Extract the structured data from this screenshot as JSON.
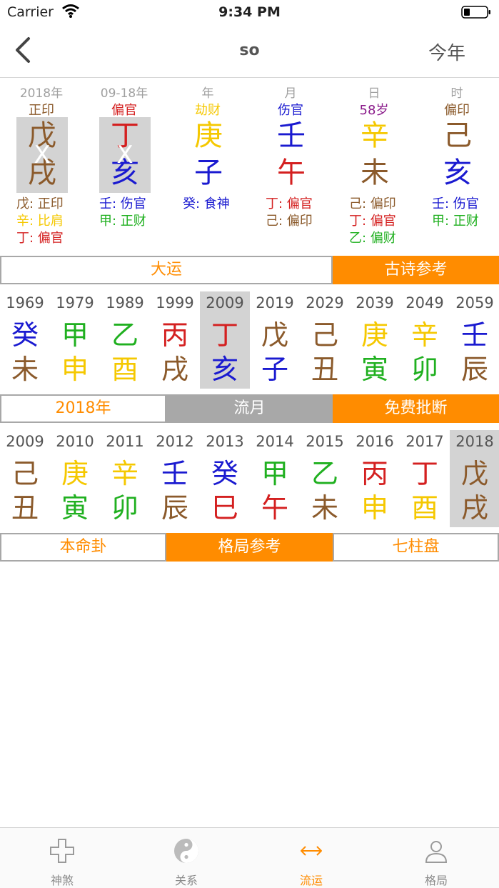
{
  "status": {
    "carrier": "Carrier",
    "time": "9:34 PM"
  },
  "nav": {
    "title": "so",
    "right": "今年"
  },
  "colors": {
    "accent": "#ff8c00",
    "brown": "#8b5a2b",
    "red": "#d42020",
    "blue": "#1a1ad0",
    "green": "#20b020",
    "yellow": "#f5c800",
    "purple": "#8a1a8a",
    "grey": "#a0a0a0"
  },
  "pillars": [
    {
      "lab1": "2018年",
      "lab2": "正印",
      "lab2_color": "#8b5a2b",
      "c1": "戊",
      "c1_color": "#8b5a2b",
      "c2": "戌",
      "c2_color": "#8b5a2b",
      "grey": true,
      "x": "X",
      "hidden": [
        {
          "t": "戊: 正印",
          "c": "#8b5a2b"
        },
        {
          "t": "辛: 比肩",
          "c": "#f5c800"
        },
        {
          "t": "丁: 偏官",
          "c": "#d42020"
        }
      ]
    },
    {
      "lab1": "09-18年",
      "lab2": "偏官",
      "lab2_color": "#d42020",
      "c1": "丁",
      "c1_color": "#d42020",
      "c2": "亥",
      "c2_color": "#1a1ad0",
      "grey": true,
      "x": "X",
      "hidden": [
        {
          "t": "壬: 伤官",
          "c": "#1a1ad0"
        },
        {
          "t": "甲: 正财",
          "c": "#20b020"
        }
      ]
    },
    {
      "lab1": "年",
      "lab2": "劫财",
      "lab2_color": "#f5c800",
      "c1": "庚",
      "c1_color": "#f5c800",
      "c2": "子",
      "c2_color": "#1a1ad0",
      "grey": false,
      "x": "",
      "hidden": [
        {
          "t": "癸: 食神",
          "c": "#1a1ad0"
        }
      ]
    },
    {
      "lab1": "月",
      "lab2": "伤官",
      "lab2_color": "#1a1ad0",
      "c1": "壬",
      "c1_color": "#1a1ad0",
      "c2": "午",
      "c2_color": "#d42020",
      "grey": false,
      "x": "",
      "hidden": [
        {
          "t": "丁: 偏官",
          "c": "#d42020"
        },
        {
          "t": "己: 偏印",
          "c": "#8b5a2b"
        }
      ]
    },
    {
      "lab1": "日",
      "lab2": "58岁",
      "lab2_color": "#8a1a8a",
      "c1": "辛",
      "c1_color": "#f5c800",
      "c2": "未",
      "c2_color": "#8b5a2b",
      "grey": false,
      "x": "",
      "hidden": [
        {
          "t": "己: 偏印",
          "c": "#8b5a2b"
        },
        {
          "t": "丁: 偏官",
          "c": "#d42020"
        },
        {
          "t": "乙: 偏财",
          "c": "#20b020"
        }
      ]
    },
    {
      "lab1": "时",
      "lab2": "偏印",
      "lab2_color": "#8b5a2b",
      "c1": "己",
      "c1_color": "#8b5a2b",
      "c2": "亥",
      "c2_color": "#1a1ad0",
      "grey": false,
      "x": "",
      "hidden": [
        {
          "t": "壬: 伤官",
          "c": "#1a1ad0"
        },
        {
          "t": "甲: 正财",
          "c": "#20b020"
        }
      ]
    }
  ],
  "row1": {
    "dayun": "大运",
    "poem": "古诗参考"
  },
  "dayun": [
    {
      "y": "1969",
      "g1": "癸",
      "c1": "#1a1ad0",
      "g2": "未",
      "c2": "#8b5a2b",
      "sel": false
    },
    {
      "y": "1979",
      "g1": "甲",
      "c1": "#20b020",
      "g2": "申",
      "c2": "#f5c800",
      "sel": false
    },
    {
      "y": "1989",
      "g1": "乙",
      "c1": "#20b020",
      "g2": "酉",
      "c2": "#f5c800",
      "sel": false
    },
    {
      "y": "1999",
      "g1": "丙",
      "c1": "#d42020",
      "g2": "戌",
      "c2": "#8b5a2b",
      "sel": false
    },
    {
      "y": "2009",
      "g1": "丁",
      "c1": "#d42020",
      "g2": "亥",
      "c2": "#1a1ad0",
      "sel": true
    },
    {
      "y": "2019",
      "g1": "戊",
      "c1": "#8b5a2b",
      "g2": "子",
      "c2": "#1a1ad0",
      "sel": false
    },
    {
      "y": "2029",
      "g1": "己",
      "c1": "#8b5a2b",
      "g2": "丑",
      "c2": "#8b5a2b",
      "sel": false
    },
    {
      "y": "2039",
      "g1": "庚",
      "c1": "#f5c800",
      "g2": "寅",
      "c2": "#20b020",
      "sel": false
    },
    {
      "y": "2049",
      "g1": "辛",
      "c1": "#f5c800",
      "g2": "卯",
      "c2": "#20b020",
      "sel": false
    },
    {
      "y": "2059",
      "g1": "壬",
      "c1": "#1a1ad0",
      "g2": "辰",
      "c2": "#8b5a2b",
      "sel": false
    }
  ],
  "row2": {
    "year": "2018年",
    "liuyue": "流月",
    "free": "免费批断"
  },
  "liunian": [
    {
      "y": "2009",
      "g1": "己",
      "c1": "#8b5a2b",
      "g2": "丑",
      "c2": "#8b5a2b",
      "sel": false
    },
    {
      "y": "2010",
      "g1": "庚",
      "c1": "#f5c800",
      "g2": "寅",
      "c2": "#20b020",
      "sel": false
    },
    {
      "y": "2011",
      "g1": "辛",
      "c1": "#f5c800",
      "g2": "卯",
      "c2": "#20b020",
      "sel": false
    },
    {
      "y": "2012",
      "g1": "壬",
      "c1": "#1a1ad0",
      "g2": "辰",
      "c2": "#8b5a2b",
      "sel": false
    },
    {
      "y": "2013",
      "g1": "癸",
      "c1": "#1a1ad0",
      "g2": "巳",
      "c2": "#d42020",
      "sel": false
    },
    {
      "y": "2014",
      "g1": "甲",
      "c1": "#20b020",
      "g2": "午",
      "c2": "#d42020",
      "sel": false
    },
    {
      "y": "2015",
      "g1": "乙",
      "c1": "#20b020",
      "g2": "未",
      "c2": "#8b5a2b",
      "sel": false
    },
    {
      "y": "2016",
      "g1": "丙",
      "c1": "#d42020",
      "g2": "申",
      "c2": "#f5c800",
      "sel": false
    },
    {
      "y": "2017",
      "g1": "丁",
      "c1": "#d42020",
      "g2": "酉",
      "c2": "#f5c800",
      "sel": false
    },
    {
      "y": "2018",
      "g1": "戊",
      "c1": "#8b5a2b",
      "g2": "戌",
      "c2": "#8b5a2b",
      "sel": true
    }
  ],
  "row3": {
    "bmg": "本命卦",
    "gj": "格局参考",
    "qzp": "七柱盘"
  },
  "tabs": [
    {
      "label": "神煞",
      "icon": "cross-icon",
      "active": false
    },
    {
      "label": "关系",
      "icon": "yinyang-icon",
      "active": false
    },
    {
      "label": "流运",
      "icon": "double-arrow-icon",
      "active": true
    },
    {
      "label": "格局",
      "icon": "person-icon",
      "active": false
    }
  ]
}
